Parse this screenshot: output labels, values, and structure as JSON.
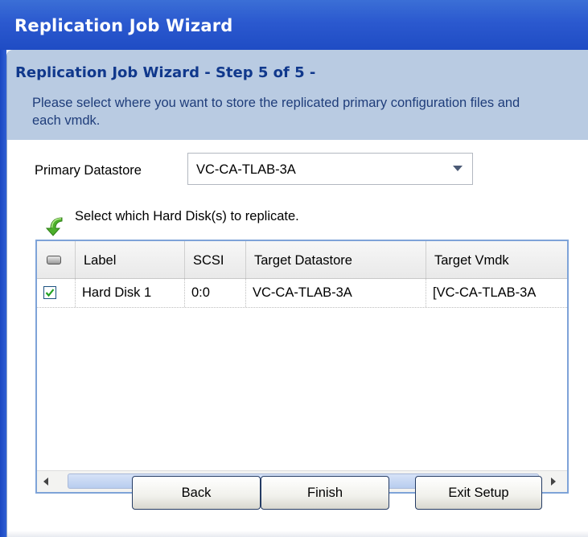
{
  "window": {
    "title": "Replication Job Wizard"
  },
  "header": {
    "step_title": "Replication Job Wizard - Step 5 of 5 -",
    "description": "Please select where you want to store the replicated primary configuration files and each vmdk."
  },
  "datastore": {
    "label": "Primary Datastore",
    "selected": "VC-CA-TLAB-3A"
  },
  "disks": {
    "instruction": "Select which Hard Disk(s) to replicate.",
    "columns": [
      "Label",
      "SCSI",
      "Target Datastore",
      "Target Vmdk"
    ],
    "rows": [
      {
        "checked": true,
        "label": "Hard Disk 1",
        "scsi": "0:0",
        "target_datastore": "VC-CA-TLAB-3A",
        "target_vmdk": "[VC-CA-TLAB-3A"
      }
    ]
  },
  "buttons": {
    "back": "Back",
    "finish": "Finish",
    "exit": "Exit Setup"
  },
  "colors": {
    "titlebar": "#2b59cf",
    "header_band": "#b9cbe2",
    "step_title": "#10388c",
    "grid_border": "#7ea3d8"
  }
}
